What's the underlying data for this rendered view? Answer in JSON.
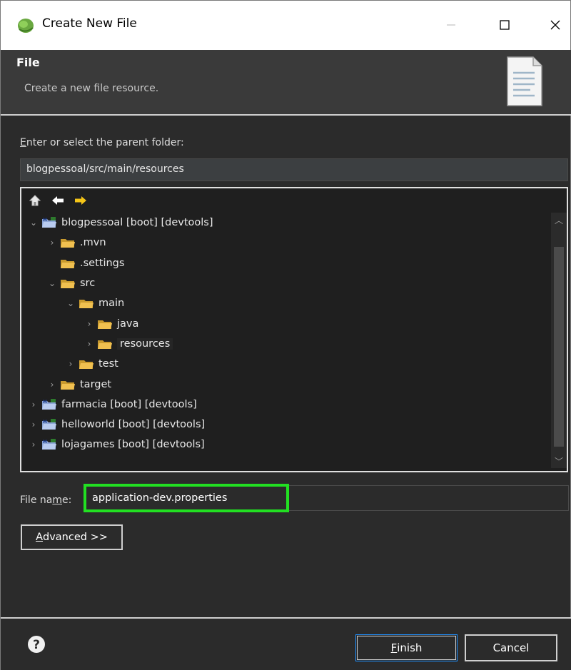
{
  "window": {
    "title": "Create New File",
    "min_label": "—",
    "max_label": "☐",
    "close_label": "✕"
  },
  "header": {
    "title": "File",
    "description": "Create a new file resource."
  },
  "parent_folder": {
    "label_access": "E",
    "label_rest": "nter or select the parent folder:",
    "value": "blogpessoal/src/main/resources"
  },
  "tree": {
    "toolbar": [
      "home-icon",
      "back-arrow-icon",
      "forward-arrow-icon"
    ],
    "items": [
      {
        "label": "blogpessoal [boot] [devtools]",
        "kind": "project",
        "chevron": "⌄",
        "depth": 0
      },
      {
        "label": ".mvn",
        "kind": "folder",
        "chevron": "›",
        "depth": 1
      },
      {
        "label": ".settings",
        "kind": "folder",
        "chevron": "",
        "depth": 1
      },
      {
        "label": "src",
        "kind": "folder",
        "chevron": "⌄",
        "depth": 1
      },
      {
        "label": "main",
        "kind": "folder",
        "chevron": "⌄",
        "depth": 2
      },
      {
        "label": "java",
        "kind": "folder",
        "chevron": "›",
        "depth": 3
      },
      {
        "label": "resources",
        "kind": "folder",
        "chevron": "›",
        "depth": 3,
        "selected": true
      },
      {
        "label": "test",
        "kind": "folder",
        "chevron": "›",
        "depth": 2
      },
      {
        "label": "target",
        "kind": "folder",
        "chevron": "›",
        "depth": 1
      },
      {
        "label": "farmacia [boot] [devtools]",
        "kind": "project",
        "chevron": "›",
        "depth": 0
      },
      {
        "label": "helloworld [boot] [devtools]",
        "kind": "project",
        "chevron": "›",
        "depth": 0
      },
      {
        "label": "lojagames [boot] [devtools]",
        "kind": "project",
        "chevron": "›",
        "depth": 0
      }
    ]
  },
  "file_name": {
    "label_pre": "File na",
    "label_access": "m",
    "label_post": "e:",
    "value": "application-dev.properties"
  },
  "advanced": {
    "access": "A",
    "rest": "dvanced >>"
  },
  "footer": {
    "finish_access": "F",
    "finish_rest": "inish",
    "cancel_label": "Cancel"
  },
  "colors": {
    "dialog_bg": "#2b2b2b",
    "header_bg": "#3a3a3a",
    "highlight": "#22e022",
    "default_button_border": "#1e90ff",
    "folder": "#e8b84a"
  }
}
